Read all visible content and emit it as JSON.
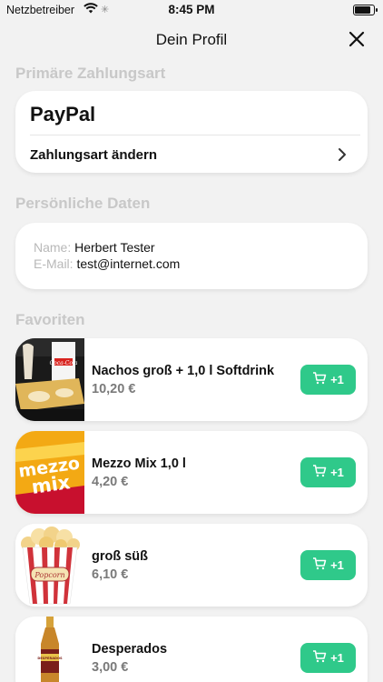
{
  "status_bar": {
    "carrier": "Netzbetreiber",
    "time": "8:45 PM",
    "battery_level": 0.9
  },
  "nav": {
    "title": "Dein Profil",
    "close_icon": "close-icon"
  },
  "payment": {
    "section_title": "Primäre Zahlungsart",
    "method": "PayPal",
    "change_label": "Zahlungsart ändern",
    "chevron_icon": "chevron-right-icon"
  },
  "personal": {
    "section_title": "Persönliche Daten",
    "name_label": "Name:",
    "name_value": "Herbert Tester",
    "email_label": "E-Mail:",
    "email_value": "test@internet.com"
  },
  "favorites": {
    "section_title": "Favoriten",
    "items": [
      {
        "name": "Nachos groß + 1,0 l Softdrink",
        "price": "10,20 €",
        "button_label": "+1",
        "icon": "cart-icon"
      },
      {
        "name": "Mezzo Mix 1,0 l",
        "price": "4,20 €",
        "button_label": "+1",
        "icon": "cart-icon"
      },
      {
        "name": "groß süß",
        "price": "6,10 €",
        "button_label": "+1",
        "icon": "cart-icon"
      },
      {
        "name": "Desperados",
        "price": "3,00 €",
        "button_label": "+1",
        "icon": "cart-icon"
      }
    ]
  },
  "colors": {
    "accent": "#2fc98a",
    "background": "#f2f2f2",
    "section_header": "#c8c8c8",
    "price": "#7a7a7a"
  },
  "images": {
    "nachos": {
      "logo_text": "Coca-Cola"
    },
    "mezzo": {
      "logo_top": "mezzo",
      "logo_bottom": "mix"
    },
    "popcorn": {
      "logo_text": "Popcorn"
    },
    "desperados": {
      "logo_text": "DESPERADOS"
    }
  }
}
